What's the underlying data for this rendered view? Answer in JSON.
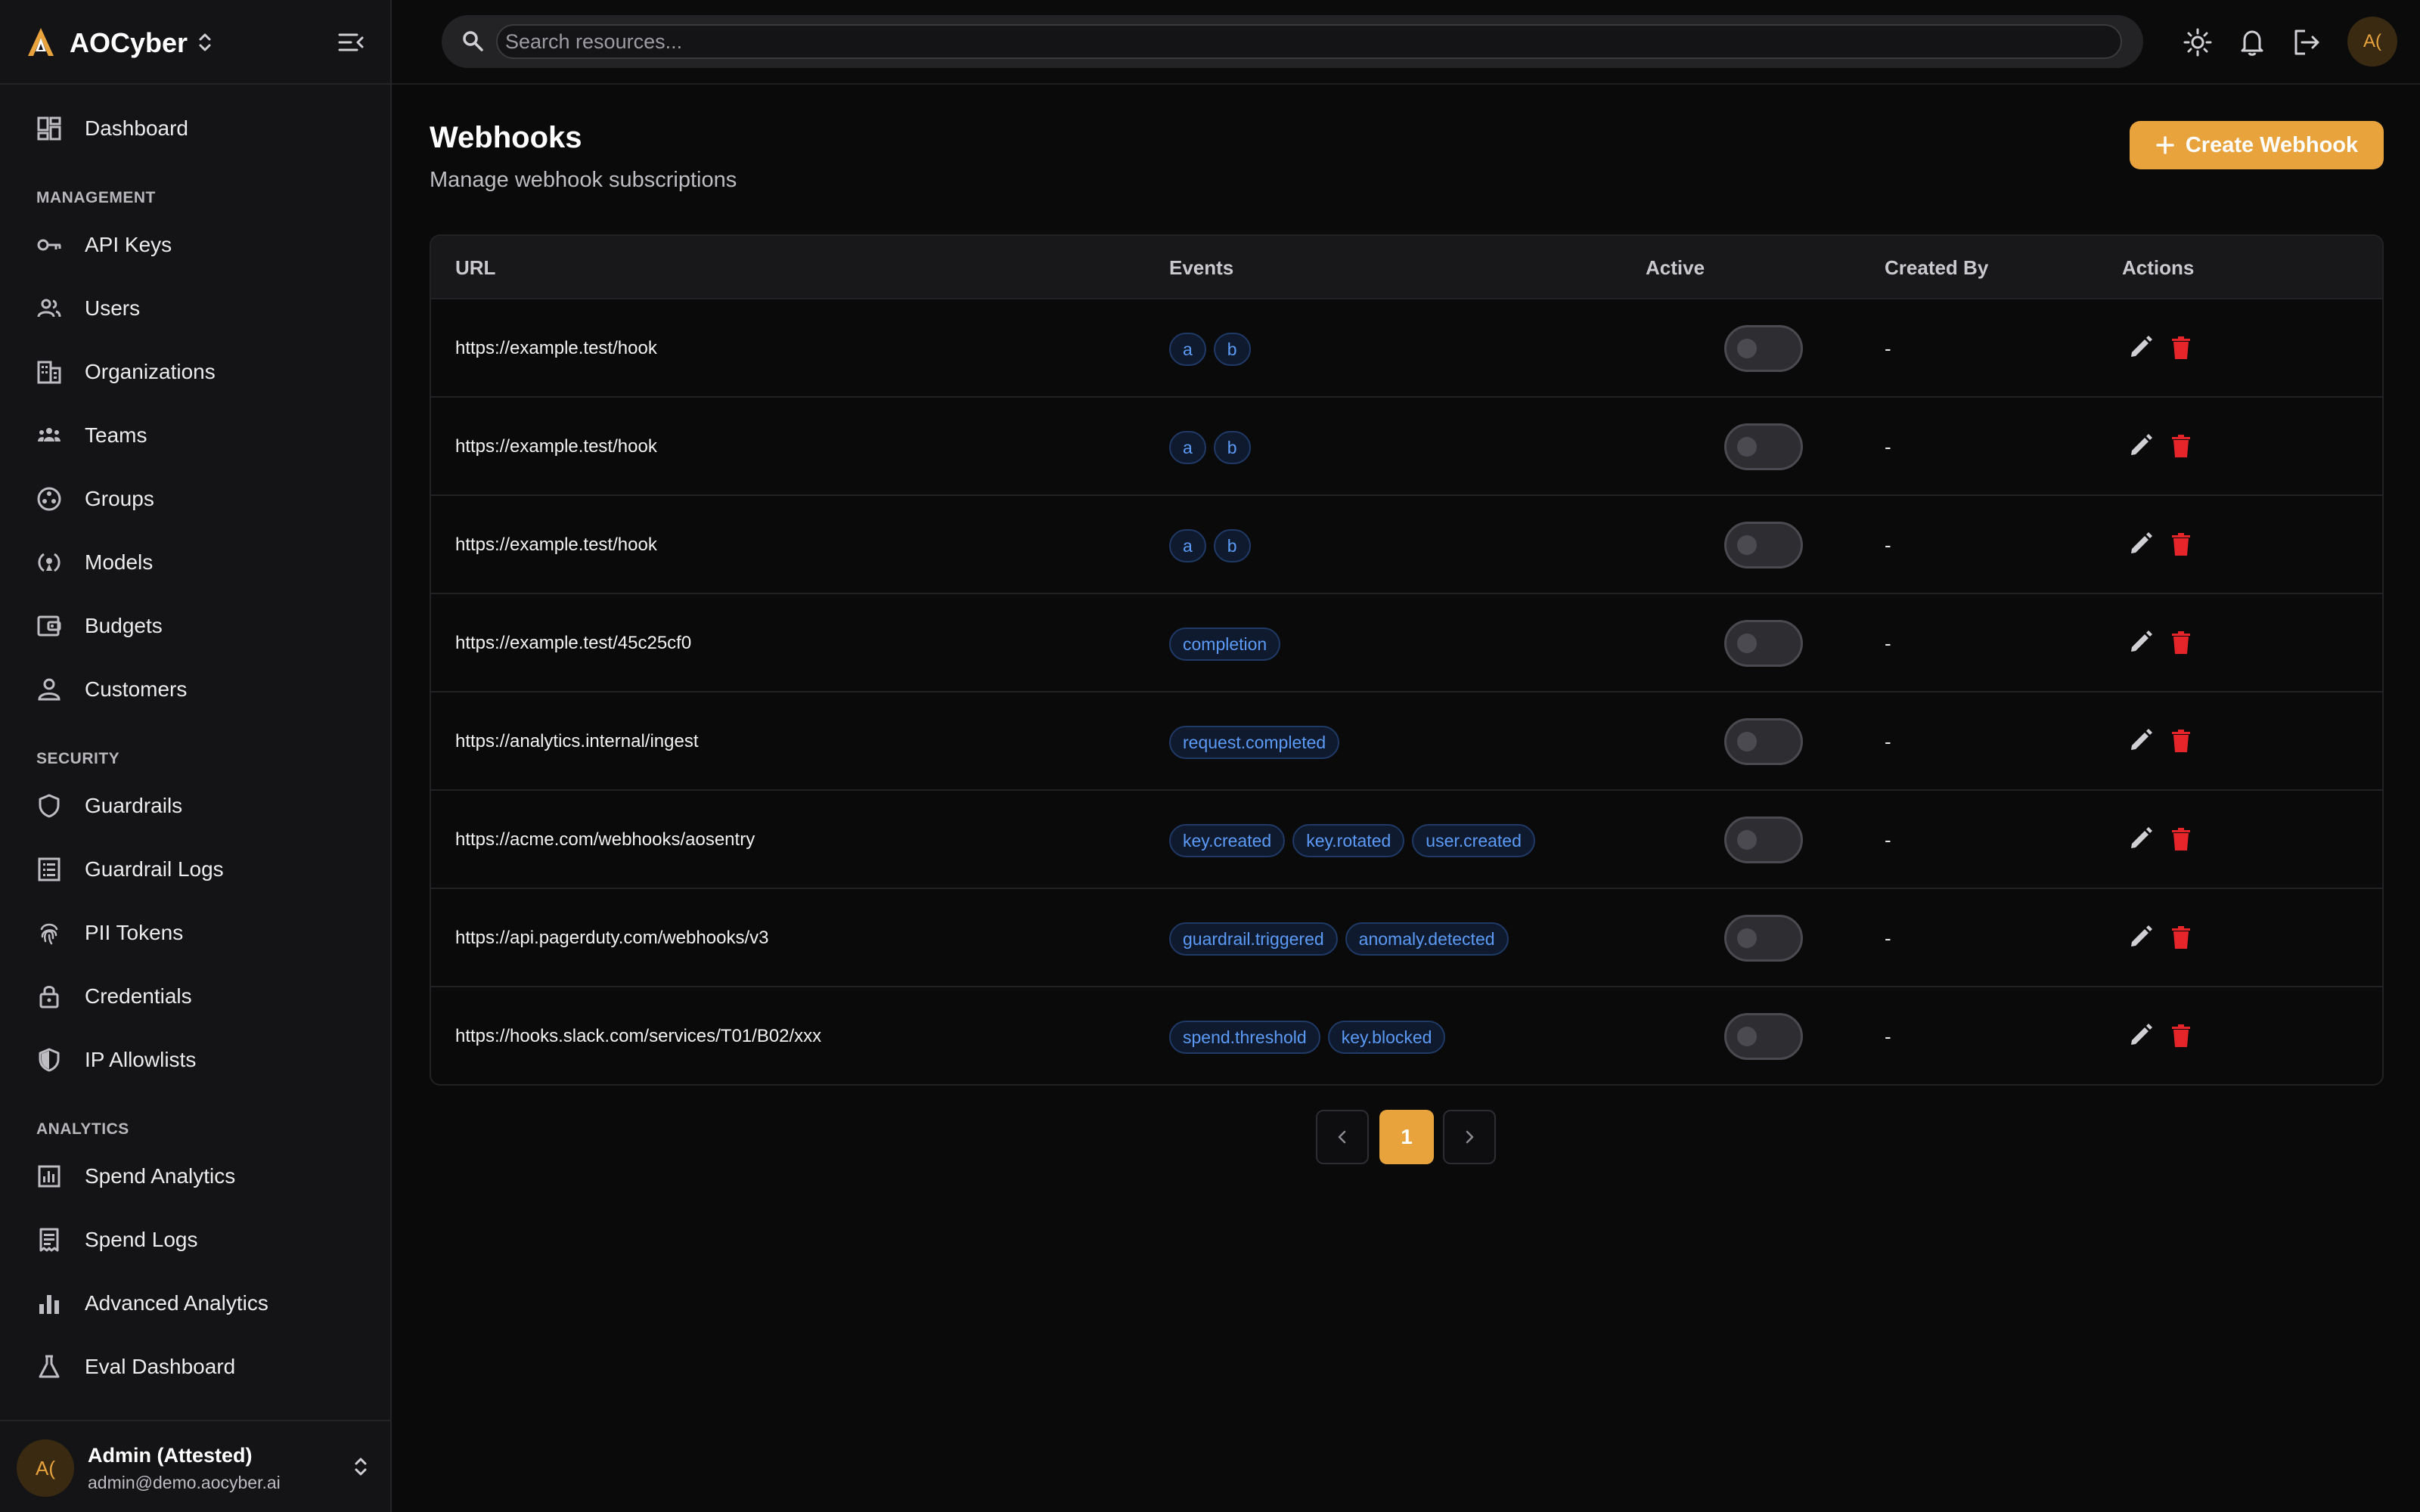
{
  "app": {
    "name": "AOCyber"
  },
  "sidebar": {
    "dashboard": "Dashboard",
    "sections": {
      "management": "MANAGEMENT",
      "security": "SECURITY",
      "analytics": "ANALYTICS"
    },
    "management_items": [
      "API Keys",
      "Users",
      "Organizations",
      "Teams",
      "Groups",
      "Models",
      "Budgets",
      "Customers"
    ],
    "security_items": [
      "Guardrails",
      "Guardrail Logs",
      "PII Tokens",
      "Credentials",
      "IP Allowlists"
    ],
    "analytics_items": [
      "Spend Analytics",
      "Spend Logs",
      "Advanced Analytics",
      "Eval Dashboard"
    ],
    "user": {
      "initials": "A(",
      "name": "Admin (Attested)",
      "email": "admin@demo.aocyber.ai"
    }
  },
  "topbar": {
    "search_placeholder": "Search resources...",
    "avatar_initials": "A("
  },
  "page": {
    "title": "Webhooks",
    "subtitle": "Manage webhook subscriptions",
    "create_button": "Create Webhook"
  },
  "table": {
    "headers": {
      "url": "URL",
      "events": "Events",
      "active": "Active",
      "created_by": "Created By",
      "actions": "Actions"
    },
    "rows": [
      {
        "url": "https://example.test/hook",
        "events": [
          "a",
          "b"
        ],
        "active": false,
        "created_by": "-"
      },
      {
        "url": "https://example.test/hook",
        "events": [
          "a",
          "b"
        ],
        "active": false,
        "created_by": "-"
      },
      {
        "url": "https://example.test/hook",
        "events": [
          "a",
          "b"
        ],
        "active": false,
        "created_by": "-"
      },
      {
        "url": "https://example.test/45c25cf0",
        "events": [
          "completion"
        ],
        "active": false,
        "created_by": "-"
      },
      {
        "url": "https://analytics.internal/ingest",
        "events": [
          "request.completed"
        ],
        "active": false,
        "created_by": "-"
      },
      {
        "url": "https://acme.com/webhooks/aosentry",
        "events": [
          "key.created",
          "key.rotated",
          "user.created"
        ],
        "active": false,
        "created_by": "-"
      },
      {
        "url": "https://api.pagerduty.com/webhooks/v3",
        "events": [
          "guardrail.triggered",
          "anomaly.detected"
        ],
        "active": false,
        "created_by": "-"
      },
      {
        "url": "https://hooks.slack.com/services/T01/B02/xxx",
        "events": [
          "spend.threshold",
          "key.blocked"
        ],
        "active": false,
        "created_by": "-"
      }
    ]
  },
  "pagination": {
    "current_page": "1"
  },
  "colors": {
    "accent": "#e8a33c",
    "badge_text": "#5b9af5",
    "delete": "#e5252a",
    "background": "#0a0a0a",
    "sidebar": "#141416"
  }
}
